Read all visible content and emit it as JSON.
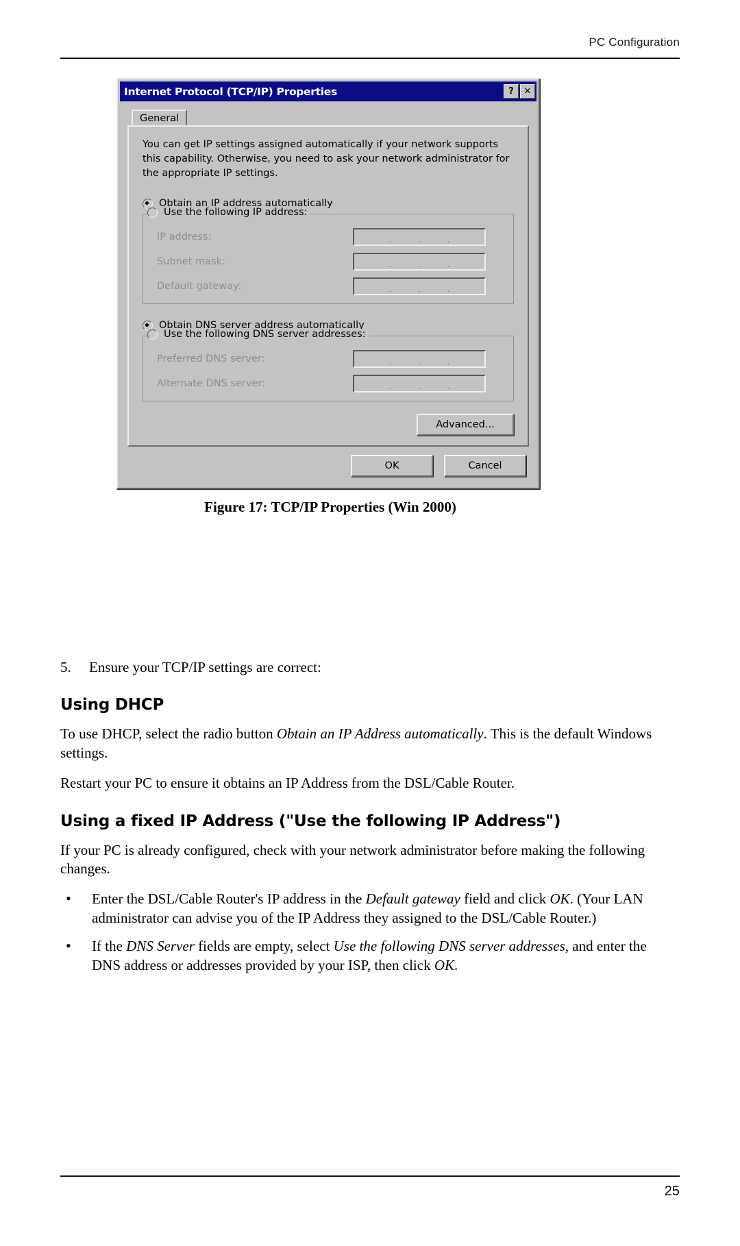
{
  "header": {
    "title": "PC Configuration"
  },
  "footer": {
    "page_number": "25"
  },
  "figure": {
    "caption": "Figure 17: TCP/IP Properties (Win 2000)",
    "dialog": {
      "title": "Internet Protocol (TCP/IP) Properties",
      "help_button": "?",
      "close_button": "✕",
      "tab_general": "General",
      "intro_line1": "You can get IP settings assigned automatically if your network supports",
      "intro_line2": "this capability. Otherwise, you need to ask your network administrator for",
      "intro_line3": "the appropriate IP settings.",
      "radio_obtain_ip": "Obtain an IP address automatically",
      "radio_use_ip": "Use the following IP address:",
      "label_ip_address": "IP address:",
      "label_subnet_mask": "Subnet mask:",
      "label_default_gateway": "Default gateway:",
      "radio_obtain_dns": "Obtain DNS server address automatically",
      "radio_use_dns": "Use the following DNS server addresses:",
      "label_preferred_dns": "Preferred DNS server:",
      "label_alternate_dns": "Alternate DNS server:",
      "button_advanced": "Advanced...",
      "button_ok": "OK",
      "button_cancel": "Cancel",
      "ip_value": "",
      "subnet_value": "",
      "gateway_value": "",
      "preferred_dns_value": "",
      "alternate_dns_value": "",
      "selected_ip_mode": "Obtain an IP address automatically",
      "selected_dns_mode": "Obtain DNS server address automatically",
      "titlebar_color": "#0b0b86",
      "face_color": "#c3c3c3"
    }
  },
  "body": {
    "step_number": "5.",
    "step_text": "Ensure your TCP/IP settings are correct:",
    "heading_dhcp": "Using DHCP",
    "dhcp_para1_a": "To use DHCP, select the radio button ",
    "dhcp_para1_em": "Obtain an IP Address automatically",
    "dhcp_para1_b": ". This is the default Windows settings.",
    "dhcp_para2": "Restart your PC to ensure it obtains an IP Address from the DSL/Cable Router.",
    "heading_fixed": "Using a fixed IP Address (\"Use the following IP Address\")",
    "fixed_para1": "If your PC is already configured, check with your network administrator before making the following changes.",
    "bullet1_a": "Enter the DSL/Cable Router's IP address in the ",
    "bullet1_em1": "Default gateway",
    "bullet1_b": " field and click ",
    "bullet1_em2": "OK",
    "bullet1_c": ". (Your LAN administrator can advise you of the IP Address they assigned to the DSL/Cable Router.)",
    "bullet2_a": "If the ",
    "bullet2_em1": "DNS Server",
    "bullet2_b": " fields are empty, select ",
    "bullet2_em2": "Use the following DNS server addresses",
    "bullet2_c": ", and enter the DNS address or addresses provided by your ISP, then click ",
    "bullet2_em3": "OK",
    "bullet2_d": "."
  }
}
